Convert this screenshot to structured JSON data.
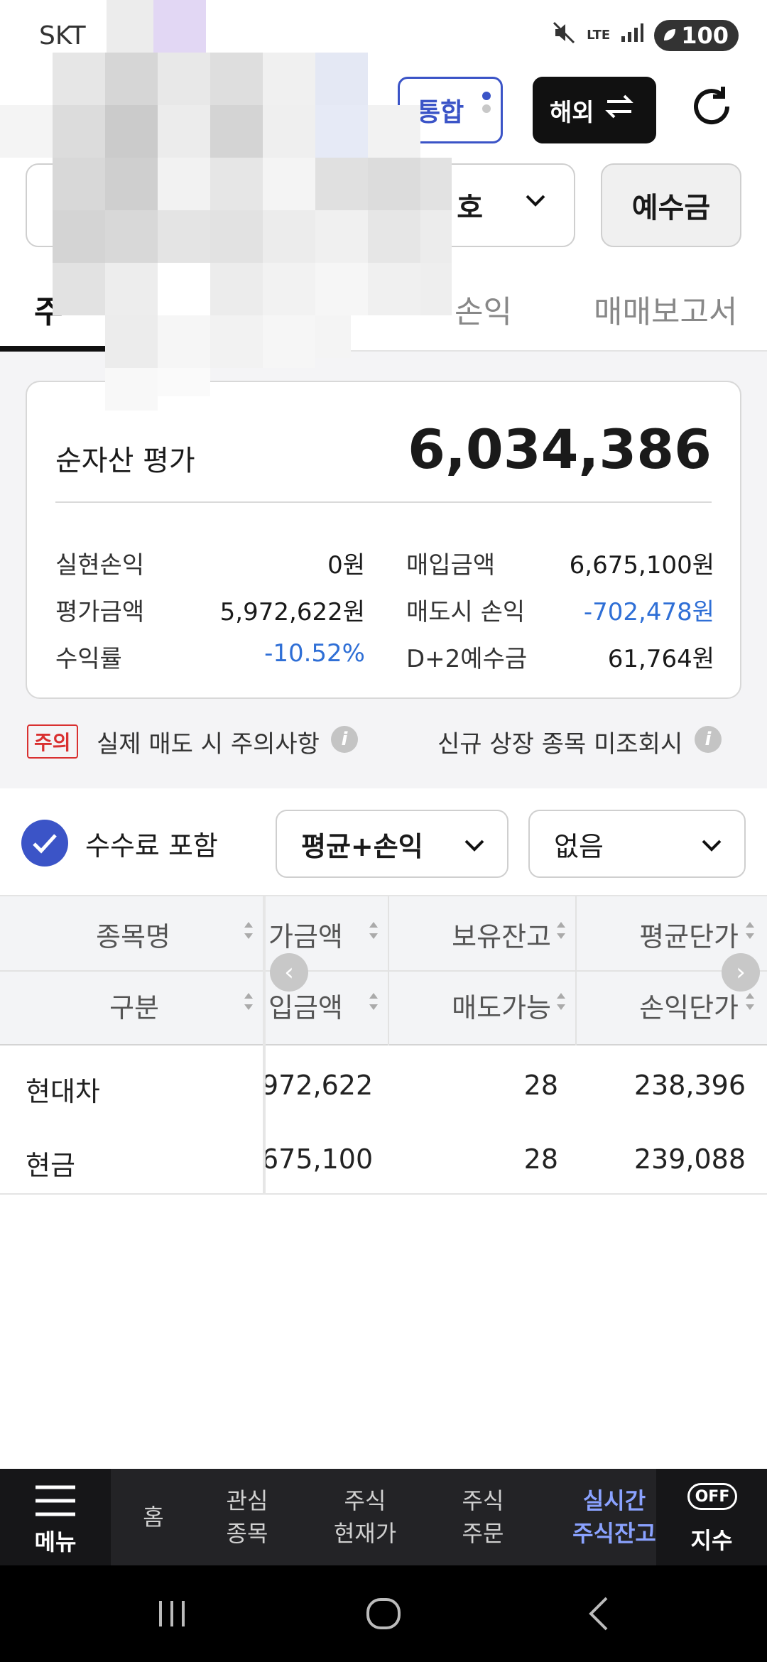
{
  "status_bar": {
    "carrier": "SKT",
    "lte": "LTE",
    "battery": "100"
  },
  "header": {
    "combined_label": "통합",
    "overseas_label": "해외"
  },
  "account": {
    "text": "호",
    "deposit_label": "예수금"
  },
  "tabs": [
    {
      "label": "주"
    },
    {
      "label": "손익"
    },
    {
      "label": "매매보고서"
    }
  ],
  "summary": {
    "net_asset_label": "순자산 평가",
    "net_asset_value": "6,034,386",
    "rows": [
      {
        "l1": "실현손익",
        "v1": "0원",
        "l2": "매입금액",
        "v2": "6,675,100원"
      },
      {
        "l1": "평가금액",
        "v1": "5,972,622원",
        "l2": "매도시 손익",
        "v2": "-702,478원"
      },
      {
        "l1": "수익률",
        "v1": "-10.52%",
        "l2": "D+2예수금",
        "v2": "61,764원"
      }
    ],
    "negative_color": "#2f6fd6"
  },
  "notice": {
    "badge": "주의",
    "sell_caution": "실제 매도 시 주의사항",
    "new_listing": "신규 상장 종목 미조회시"
  },
  "options": {
    "fee_included_label": "수수료 포함",
    "fee_included_checked": true,
    "avg_mode": "평균+손익",
    "filter": "없음"
  },
  "table": {
    "header_row1": [
      "종목명",
      "가금액",
      "보유잔고",
      "평균단가"
    ],
    "header_row2": [
      "구분",
      "입금액",
      "매도가능",
      "손익단가"
    ],
    "rows": [
      [
        "현대차",
        "972,622",
        "28",
        "238,396"
      ],
      [
        "현금",
        "675,100",
        "28",
        "239,088"
      ]
    ]
  },
  "bottom_nav": {
    "menu_label": "메뉴",
    "items": [
      {
        "line1": "홈",
        "line2": ""
      },
      {
        "line1": "관심",
        "line2": "종목"
      },
      {
        "line1": "주식",
        "line2": "현재가"
      },
      {
        "line1": "주식",
        "line2": "주문"
      },
      {
        "line1": "실시간",
        "line2": "주식잔고"
      }
    ],
    "off_badge": "OFF",
    "index_label": "지수",
    "active_color": "#8aa2ff"
  }
}
